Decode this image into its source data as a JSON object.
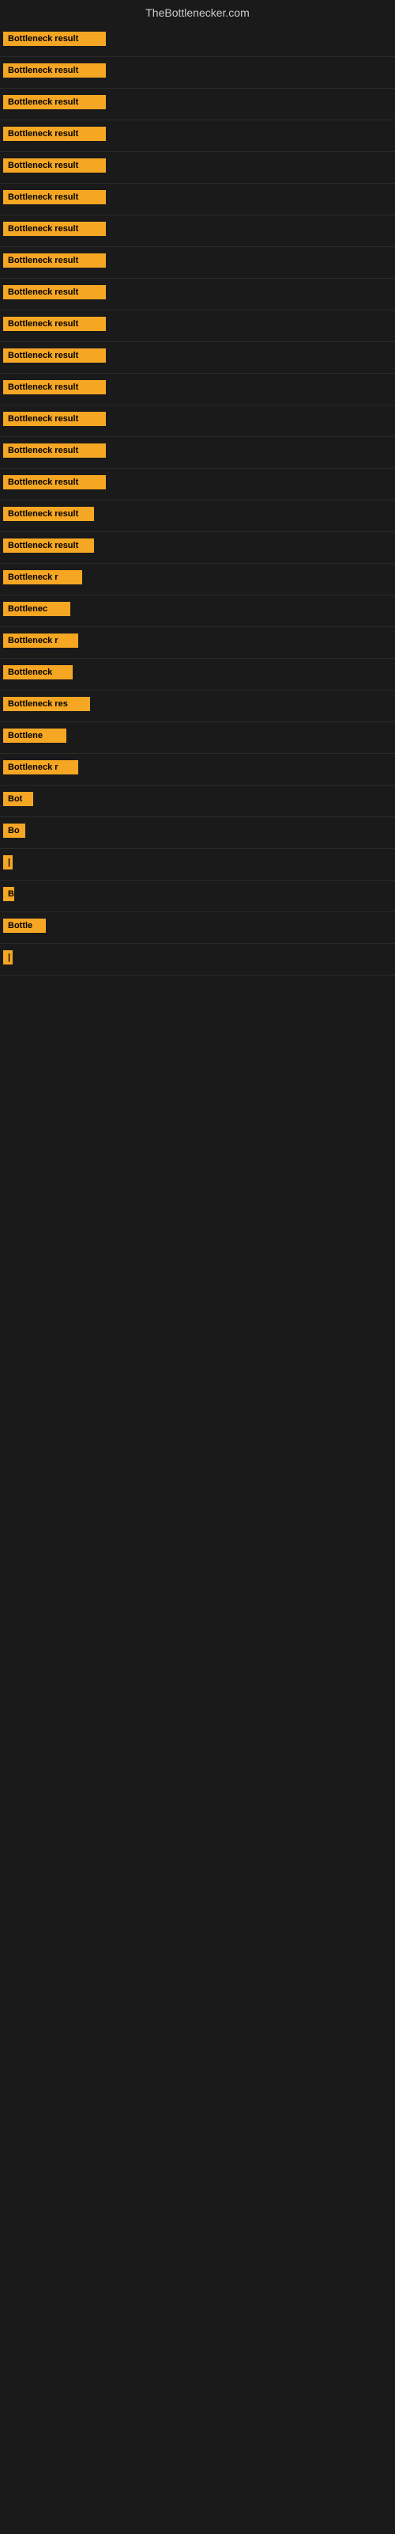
{
  "site": {
    "title": "TheBottlenecker.com"
  },
  "rows": [
    {
      "label": "Bottleneck result",
      "width": 130
    },
    {
      "label": "Bottleneck result",
      "width": 130
    },
    {
      "label": "Bottleneck result",
      "width": 130
    },
    {
      "label": "Bottleneck result",
      "width": 130
    },
    {
      "label": "Bottleneck result",
      "width": 130
    },
    {
      "label": "Bottleneck result",
      "width": 130
    },
    {
      "label": "Bottleneck result",
      "width": 130
    },
    {
      "label": "Bottleneck result",
      "width": 130
    },
    {
      "label": "Bottleneck result",
      "width": 130
    },
    {
      "label": "Bottleneck result",
      "width": 130
    },
    {
      "label": "Bottleneck result",
      "width": 130
    },
    {
      "label": "Bottleneck result",
      "width": 130
    },
    {
      "label": "Bottleneck result",
      "width": 130
    },
    {
      "label": "Bottleneck result",
      "width": 130
    },
    {
      "label": "Bottleneck result",
      "width": 130
    },
    {
      "label": "Bottleneck result",
      "width": 115
    },
    {
      "label": "Bottleneck result",
      "width": 115
    },
    {
      "label": "Bottleneck r",
      "width": 100
    },
    {
      "label": "Bottlenec",
      "width": 85
    },
    {
      "label": "Bottleneck r",
      "width": 95
    },
    {
      "label": "Bottleneck",
      "width": 88
    },
    {
      "label": "Bottleneck res",
      "width": 110
    },
    {
      "label": "Bottlene",
      "width": 80
    },
    {
      "label": "Bottleneck r",
      "width": 95
    },
    {
      "label": "Bot",
      "width": 38
    },
    {
      "label": "Bo",
      "width": 28
    },
    {
      "label": "|",
      "width": 8
    },
    {
      "label": "B",
      "width": 14
    },
    {
      "label": "Bottle",
      "width": 54
    },
    {
      "label": "|",
      "width": 8
    }
  ]
}
